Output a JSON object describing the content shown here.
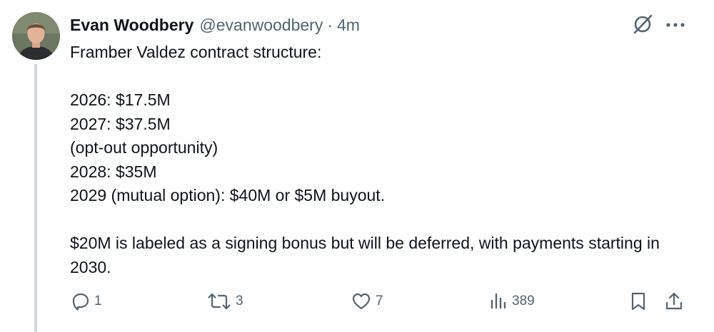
{
  "tweet": {
    "display_name": "Evan Woodbery",
    "handle": "@evanwoodbery",
    "separator": "·",
    "time": "4m",
    "lines": [
      "Framber Valdez contract structure:",
      "",
      "2026: $17.5M",
      "2027: $37.5M",
      "(opt-out opportunity)",
      "2028: $35M",
      "2029 (mutual option): $40M or $5M buyout.",
      "",
      "$20M is labeled as a signing bonus but will be deferred, with payments starting in 2030."
    ],
    "actions": {
      "replies": "1",
      "reposts": "3",
      "likes": "7",
      "views": "389"
    }
  },
  "icons": {
    "header": [
      "grok-icon",
      "more-icon"
    ],
    "actions": [
      "reply-icon",
      "repost-icon",
      "like-icon",
      "views-icon",
      "bookmark-icon",
      "share-icon"
    ]
  },
  "colors": {
    "text": "#0f1419",
    "secondary": "#536471",
    "thread_line": "#cfd9de"
  }
}
